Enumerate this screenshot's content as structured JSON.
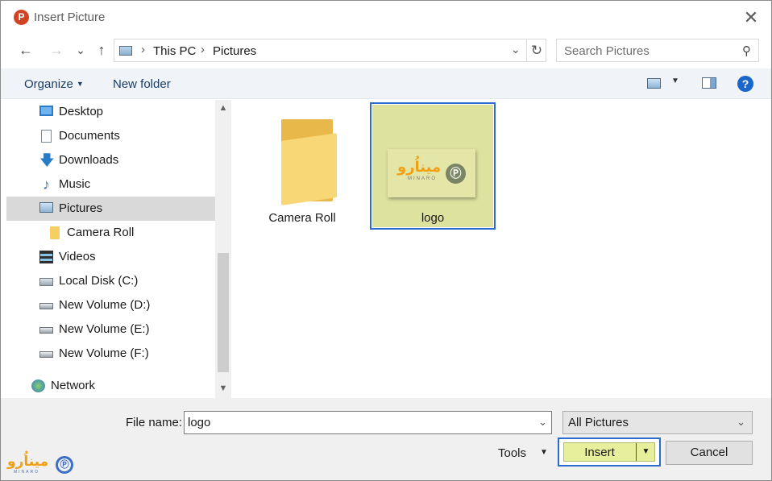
{
  "window": {
    "app_icon": "powerpoint-icon",
    "title": "Insert Picture",
    "close_glyph": "✕"
  },
  "nav": {
    "back_glyph": "←",
    "forward_glyph": "→",
    "recent_glyph": "⌄",
    "up_glyph": "↑",
    "breadcrumb": [
      "This PC",
      "Pictures"
    ],
    "separator": "›",
    "dropdown_glyph": "⌄",
    "refresh_glyph": "↻",
    "search_placeholder": "Search Pictures",
    "search_icon": "⚲"
  },
  "toolbar": {
    "organize_label": "Organize",
    "organize_caret": "▼",
    "new_folder_label": "New folder",
    "view_dd": "▼",
    "help_label": "?"
  },
  "sidebar": {
    "items": [
      {
        "label": "Desktop",
        "icon": "desktop-icon"
      },
      {
        "label": "Documents",
        "icon": "documents-icon"
      },
      {
        "label": "Downloads",
        "icon": "downloads-icon",
        "glyph": "🡇"
      },
      {
        "label": "Music",
        "icon": "music-icon",
        "glyph": "♪"
      },
      {
        "label": "Pictures",
        "icon": "pictures-icon",
        "selected": true
      },
      {
        "label": "Camera Roll",
        "icon": "folder-icon"
      },
      {
        "label": "Videos",
        "icon": "videos-icon"
      },
      {
        "label": "Local Disk (C:)",
        "icon": "local-disk-icon"
      },
      {
        "label": "New Volume (D:)",
        "icon": "drive-icon"
      },
      {
        "label": "New Volume (E:)",
        "icon": "drive-icon"
      },
      {
        "label": "New Volume (F:)",
        "icon": "drive-icon"
      },
      {
        "label": "Network",
        "icon": "network-icon"
      }
    ],
    "scroll_up": "▲",
    "scroll_down": "▼"
  },
  "content": {
    "tiles": [
      {
        "label": "Camera Roll",
        "type": "folder"
      },
      {
        "label": "logo",
        "type": "image",
        "selected": true
      }
    ],
    "logo_thumb_text": "میناُرو",
    "logo_thumb_sub": "MINARO",
    "logo_thumb_mark": "Ⓟ"
  },
  "footer": {
    "file_name_label": "File name:",
    "file_name_value": "logo",
    "file_name_dd": "⌄",
    "filter_value": "All Pictures",
    "filter_dd": "⌄",
    "tools_label": "Tools",
    "tools_dd": "▼",
    "insert_label": "Insert",
    "insert_dd": "▼",
    "cancel_label": "Cancel"
  },
  "watermark": {
    "text": "میناُرو",
    "sub": "MINARO",
    "mark": "Ⓟ"
  },
  "colors": {
    "selection_fill": "#dde29e",
    "selection_border": "#2e6bd1",
    "toolbar_bg": "#f0f4f9",
    "footer_bg": "#f0f0f0",
    "logo_orange": "#f1a012"
  }
}
